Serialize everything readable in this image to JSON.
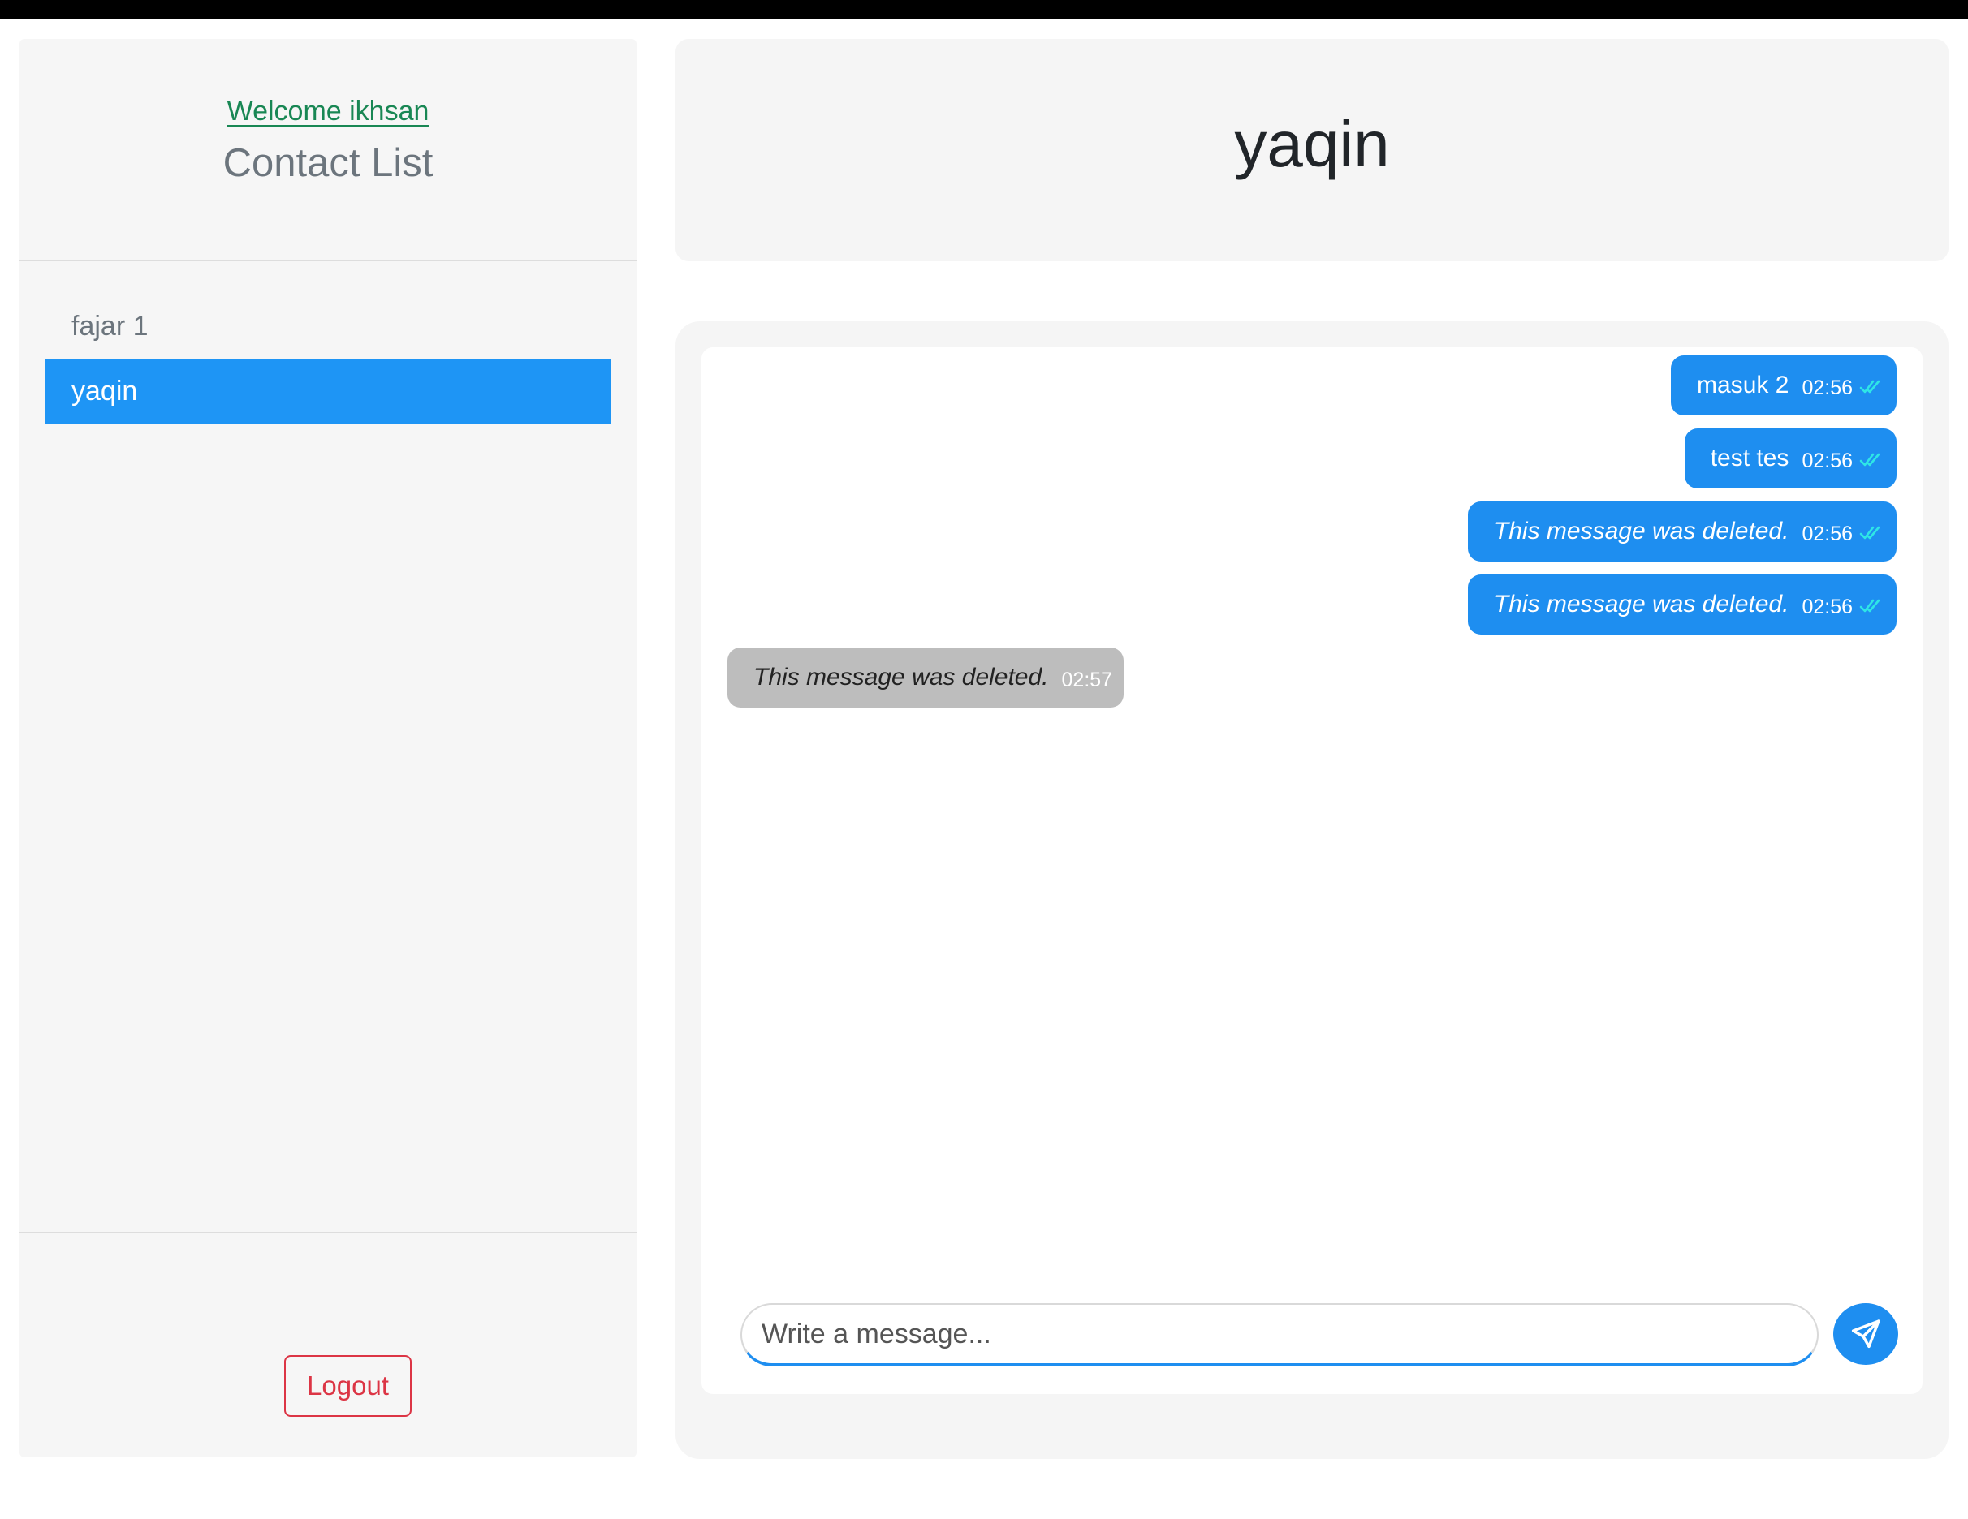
{
  "sidebar": {
    "welcome_text": "Welcome ikhsan",
    "title": "Contact List",
    "contacts": [
      {
        "name": "fajar 1",
        "active": false
      },
      {
        "name": "yaqin",
        "active": true
      }
    ],
    "logout_label": "Logout"
  },
  "chat": {
    "contact_name": "yaqin",
    "messages": [
      {
        "direction": "out",
        "text": "masuk 2",
        "time": "02:56",
        "read": true,
        "deleted": false
      },
      {
        "direction": "out",
        "text": "test tes",
        "time": "02:56",
        "read": true,
        "deleted": false
      },
      {
        "direction": "out",
        "text": "This message was deleted.",
        "time": "02:56",
        "read": true,
        "deleted": true
      },
      {
        "direction": "out",
        "text": "This message was deleted.",
        "time": "02:56",
        "read": true,
        "deleted": true
      },
      {
        "direction": "in",
        "text": "This message was deleted.",
        "time": "02:57",
        "read": false,
        "deleted": true
      }
    ],
    "input": {
      "value": "",
      "placeholder": "Write a message..."
    },
    "send_icon": "send-icon"
  },
  "colors": {
    "accent": "#1e8ef0",
    "active_contact": "#1e95f5",
    "welcome": "#198754",
    "logout": "#dc3545",
    "read_check": "#2ee6e6",
    "incoming_bubble": "#bdbdbd"
  }
}
